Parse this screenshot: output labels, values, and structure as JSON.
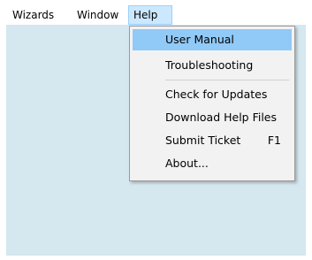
{
  "menubar": {
    "items": [
      {
        "label": "Wizards"
      },
      {
        "label": "Window"
      },
      {
        "label": "Help"
      }
    ]
  },
  "help_menu": {
    "items": [
      {
        "label": "User Manual"
      },
      {
        "label": "Troubleshooting"
      },
      {
        "label": "Check for Updates"
      },
      {
        "label": "Download Help Files"
      },
      {
        "label": "Submit Ticket",
        "shortcut": "F1"
      },
      {
        "label": "About..."
      }
    ]
  },
  "colors": {
    "client_background": "#d5e7ef",
    "menu_highlight": "#91c9f7",
    "menubar_active": "#cce8ff"
  }
}
